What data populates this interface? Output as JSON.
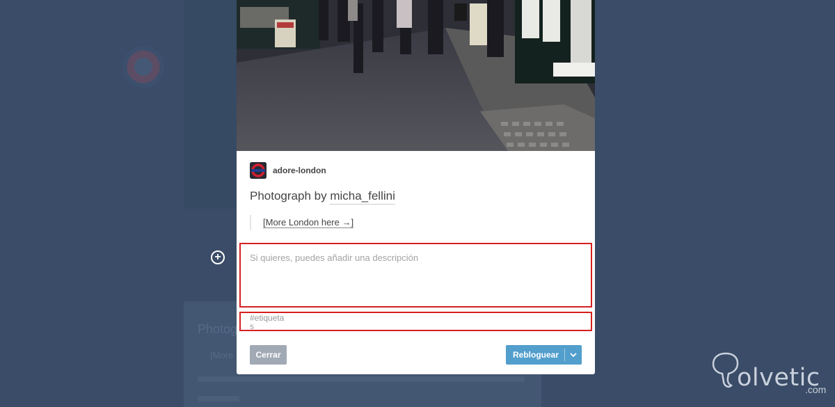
{
  "post": {
    "blog_name": "adore-london",
    "title_prefix": "Photograph by",
    "title_link": "micha_fellini",
    "quote_link": "[More London here →]"
  },
  "reblog_form": {
    "description_placeholder": "Si quieres, puedes añadir una descripción",
    "tags_placeholder": "#etiquetas"
  },
  "buttons": {
    "close_label": "Cerrar",
    "reblog_label": "Rebloguear"
  },
  "background": {
    "card_title": "Photog",
    "card_quote": "[More"
  },
  "watermark": {
    "text": "olvetic",
    "suffix": ".com"
  },
  "colors": {
    "overlay_bg": "#3a4c67",
    "highlight": "#d61f1f",
    "reblog_button": "#529ecc",
    "close_button": "#a1a9b5"
  },
  "icons": {
    "add": "plus-circle-icon",
    "dropdown": "chevron-down-icon"
  }
}
